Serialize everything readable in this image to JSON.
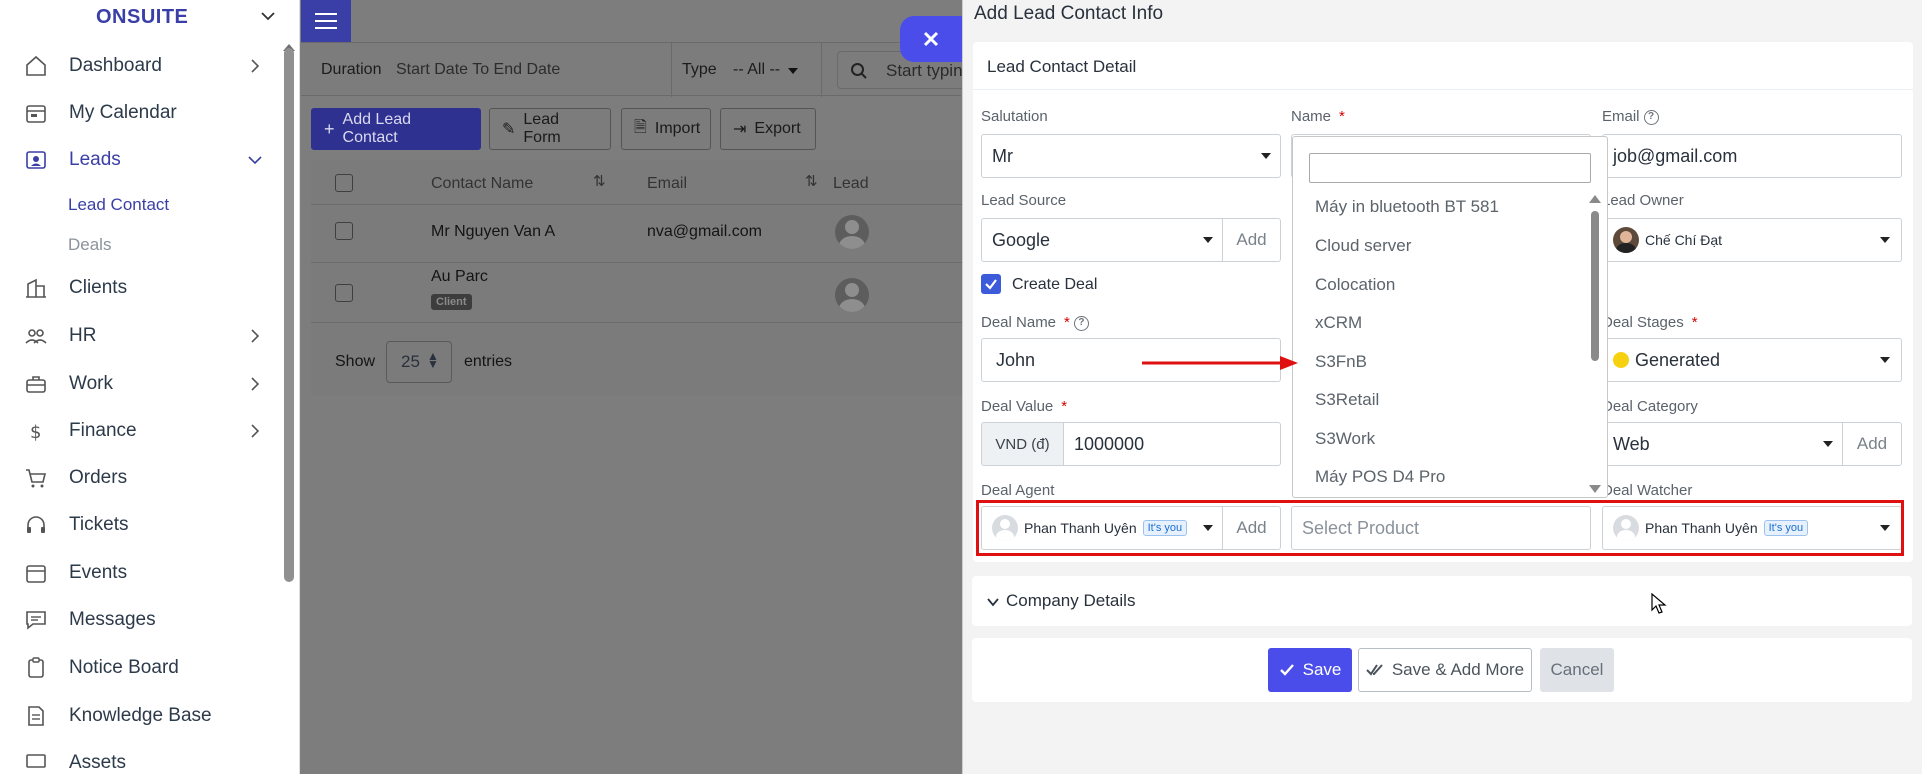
{
  "app": {
    "brand": "ONSUITE"
  },
  "sidebar": {
    "items": [
      {
        "label": "Dashboard",
        "icon": "house-icon",
        "has_chevron": true
      },
      {
        "label": "My Calendar",
        "icon": "calendar-icon",
        "has_chevron": false
      },
      {
        "label": "Leads",
        "icon": "person-card-icon",
        "has_chevron": true,
        "active": true
      },
      {
        "label": "Clients",
        "icon": "building-icon",
        "has_chevron": false
      },
      {
        "label": "HR",
        "icon": "people-icon",
        "has_chevron": true
      },
      {
        "label": "Work",
        "icon": "briefcase-icon",
        "has_chevron": true
      },
      {
        "label": "Finance",
        "icon": "dollar-icon",
        "has_chevron": true
      },
      {
        "label": "Orders",
        "icon": "cart-icon",
        "has_chevron": false
      },
      {
        "label": "Tickets",
        "icon": "headset-icon",
        "has_chevron": false
      },
      {
        "label": "Events",
        "icon": "calendar-event-icon",
        "has_chevron": false
      },
      {
        "label": "Messages",
        "icon": "message-icon",
        "has_chevron": false
      },
      {
        "label": "Notice Board",
        "icon": "clipboard-icon",
        "has_chevron": false
      },
      {
        "label": "Knowledge Base",
        "icon": "document-icon",
        "has_chevron": false
      },
      {
        "label": "Assets",
        "icon": "monitor-icon",
        "has_chevron": false
      }
    ],
    "sub_items": [
      {
        "label": "Lead Contact",
        "active": true
      },
      {
        "label": "Deals",
        "active": false
      }
    ]
  },
  "filters": {
    "duration_label": "Duration",
    "duration_value": "Start Date To End Date",
    "type_label": "Type",
    "type_value": "-- All --",
    "search_placeholder": "Start typing"
  },
  "toolbar": {
    "add_lead_contact": "Add Lead Contact",
    "lead_form": "Lead Form",
    "import": "Import",
    "export": "Export"
  },
  "table": {
    "columns": [
      "Contact Name",
      "Email",
      "Lead"
    ],
    "rows": [
      {
        "name": "Mr Nguyen Van A",
        "email": "nva@gmail.com",
        "badge": ""
      },
      {
        "name": "Au Parc",
        "email": "",
        "badge": "Client"
      }
    ],
    "show_label": "Show",
    "entries_value": "25",
    "entries_label": "entries"
  },
  "panel": {
    "title": "Add Lead Contact Info",
    "section_title": "Lead Contact Detail",
    "salutation": {
      "label": "Salutation",
      "value": "Mr"
    },
    "name": {
      "label": "Name",
      "required": "*"
    },
    "email": {
      "label": "Email",
      "value": "job@gmail.com"
    },
    "lead_source": {
      "label": "Lead Source",
      "value": "Google",
      "add": "Add"
    },
    "lead_owner": {
      "label": "Lead Owner",
      "value": "Chế Chí Đạt"
    },
    "create_deal": {
      "label": "Create Deal",
      "checked": true
    },
    "deal_name": {
      "label": "Deal Name",
      "required": "*",
      "value": "John"
    },
    "deal_stages": {
      "label": "Deal Stages",
      "required": "*",
      "value": "Generated",
      "dot_color": "#f6d110"
    },
    "deal_value": {
      "label": "Deal Value",
      "required": "*",
      "currency": "VND (đ)",
      "value": "1000000"
    },
    "deal_category": {
      "label": "Deal Category",
      "value": "Web",
      "add": "Add"
    },
    "deal_agent": {
      "label": "Deal Agent",
      "value": "Phan Thanh Uyên",
      "badge": "It's you",
      "add": "Add"
    },
    "product": {
      "placeholder": "Select Product"
    },
    "deal_watcher": {
      "label": "Deal Watcher",
      "value": "Phan Thanh Uyên",
      "badge": "It's you"
    },
    "company_details": "Company Details",
    "buttons": {
      "save": "Save",
      "save_add_more": "Save & Add More",
      "cancel": "Cancel"
    }
  },
  "product_dropdown": {
    "items": [
      "Máy in bluetooth BT 581",
      "Cloud server",
      "Colocation",
      "xCRM",
      "S3FnB",
      "S3Retail",
      "S3Work",
      "Máy POS D4 Pro"
    ]
  },
  "colors": {
    "accent": "#4b4dea",
    "brand": "#3a3ea7",
    "highlight": "#e01010",
    "required": "#d30000"
  }
}
